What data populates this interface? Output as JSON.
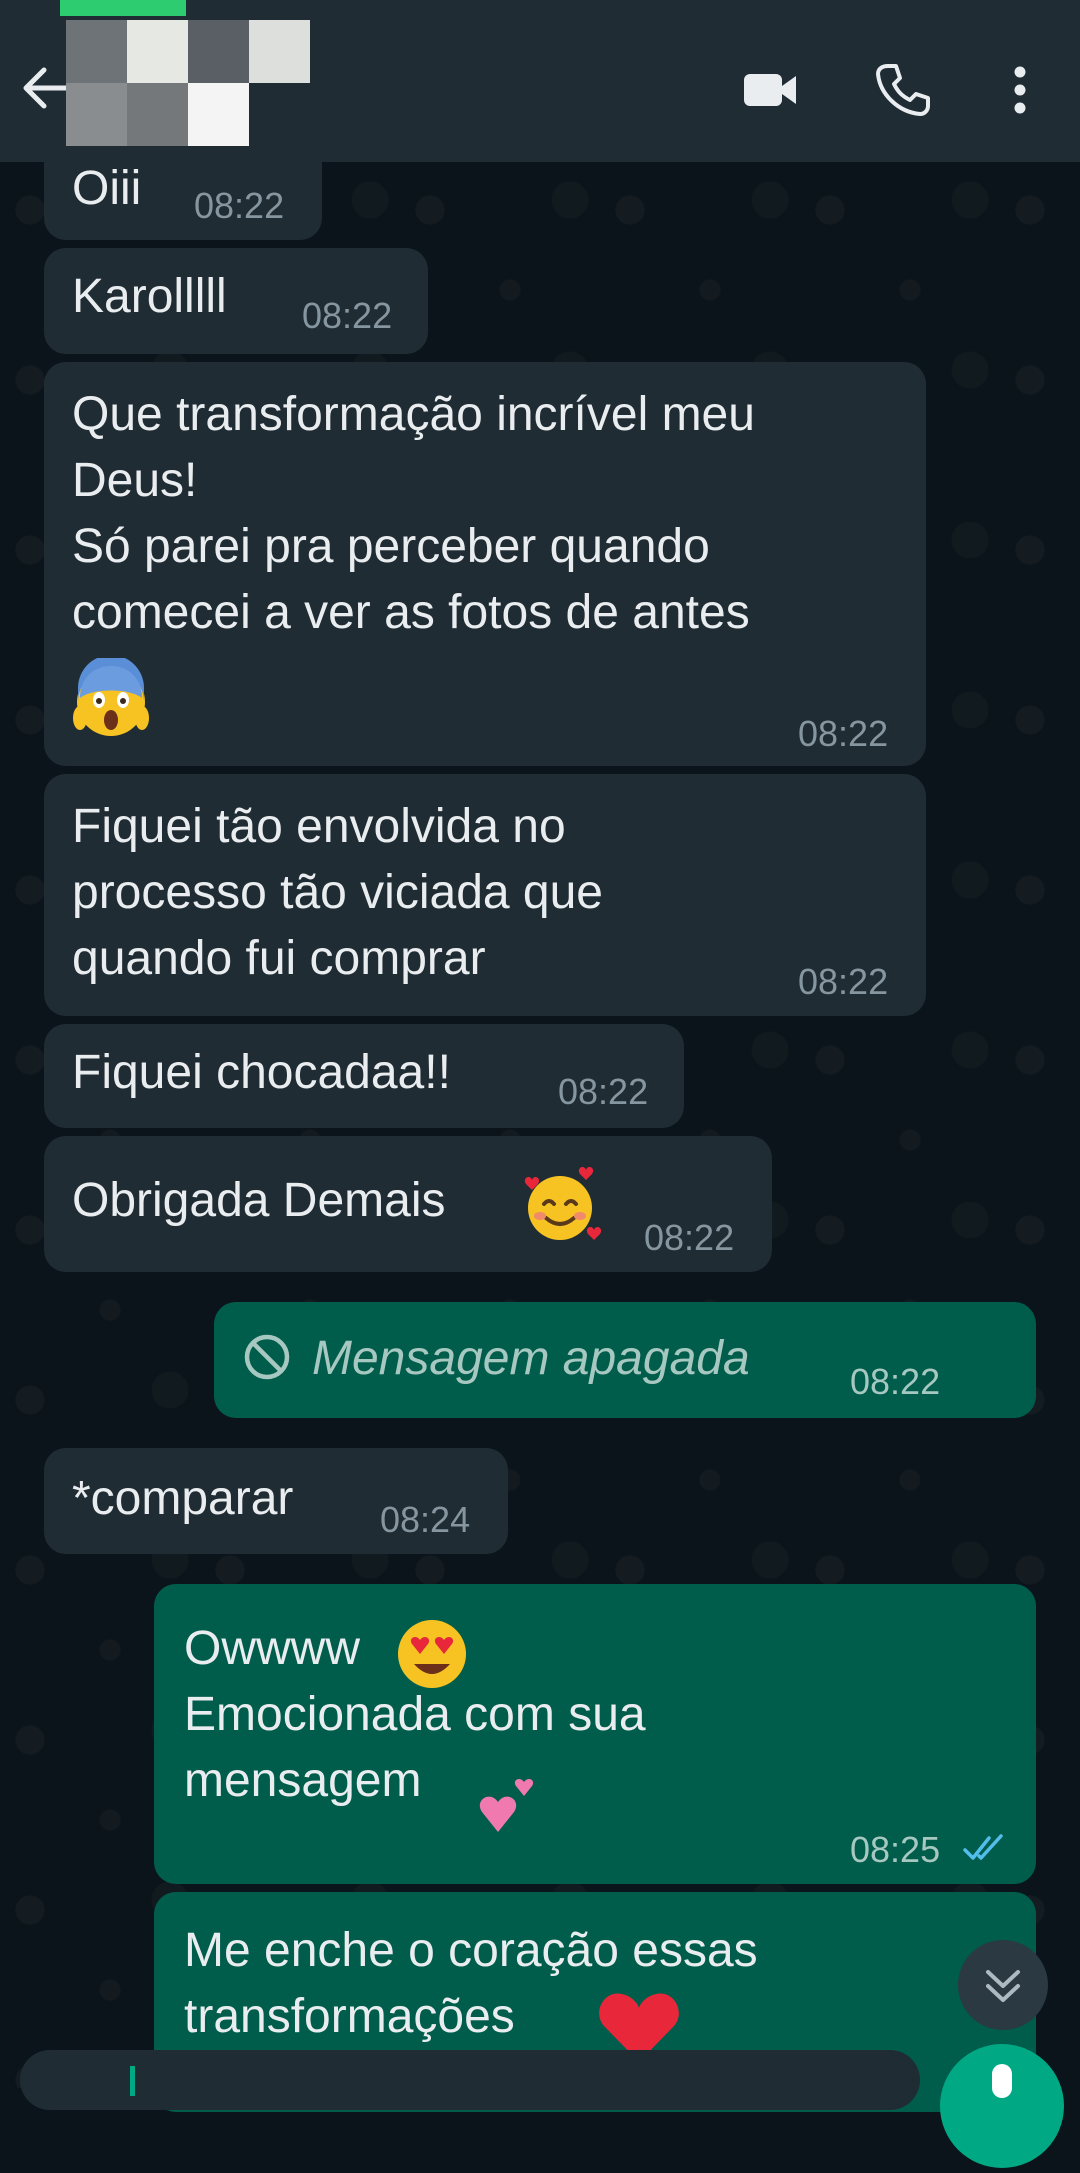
{
  "header": {
    "icons": {
      "back": "arrow-left-icon",
      "video": "video-camera-icon",
      "call": "phone-icon",
      "menu": "vertical-dots-icon"
    }
  },
  "messages": [
    {
      "dir": "in",
      "text": "Oiii",
      "time": "08:22"
    },
    {
      "dir": "in",
      "text": "Karolllll",
      "time": "08:22"
    },
    {
      "dir": "in",
      "lines": [
        "Que transformação incrível meu",
        "Deus!",
        "Só parei pra perceber quando",
        "comecei a ver as fotos de antes"
      ],
      "emoji": "screaming-face-emoji",
      "time": "08:22"
    },
    {
      "dir": "in",
      "lines": [
        "Fiquei tão envolvida no",
        "processo tão viciada que",
        "quando fui comprar"
      ],
      "time": "08:22"
    },
    {
      "dir": "in",
      "text": "Fiquei chocadaa!!",
      "time": "08:22"
    },
    {
      "dir": "in",
      "text": "Obrigada Demais",
      "emoji": "smiling-face-with-hearts-emoji",
      "time": "08:22"
    },
    {
      "dir": "out",
      "text": "Mensagem apagada",
      "deleted": true,
      "icon": "deleted-prohibited-icon",
      "time": "08:22"
    },
    {
      "dir": "in",
      "text": "*comparar",
      "time": "08:24"
    },
    {
      "dir": "out",
      "lines": [
        "Owwww",
        "Emocionada com sua",
        "mensagem"
      ],
      "emojis": [
        "heart-eyes-emoji",
        "two-hearts-emoji"
      ],
      "time": "08:25",
      "status": "read",
      "status_icon": "double-check-icon",
      "status_color": "#53bdeb"
    },
    {
      "dir": "out",
      "lines": [
        "Me enche o coração essas",
        "transformações"
      ],
      "emoji": "red-heart-emoji"
    }
  ],
  "controls": {
    "scroll_down_icon": "double-chevron-down-icon",
    "mic_icon": "microphone-icon"
  },
  "colors": {
    "header_bg": "#1f2c34",
    "incoming_bubble": "#202c33",
    "outgoing_bubble": "#005c4b",
    "wallpaper": "#0b141a",
    "accent": "#00a884"
  }
}
